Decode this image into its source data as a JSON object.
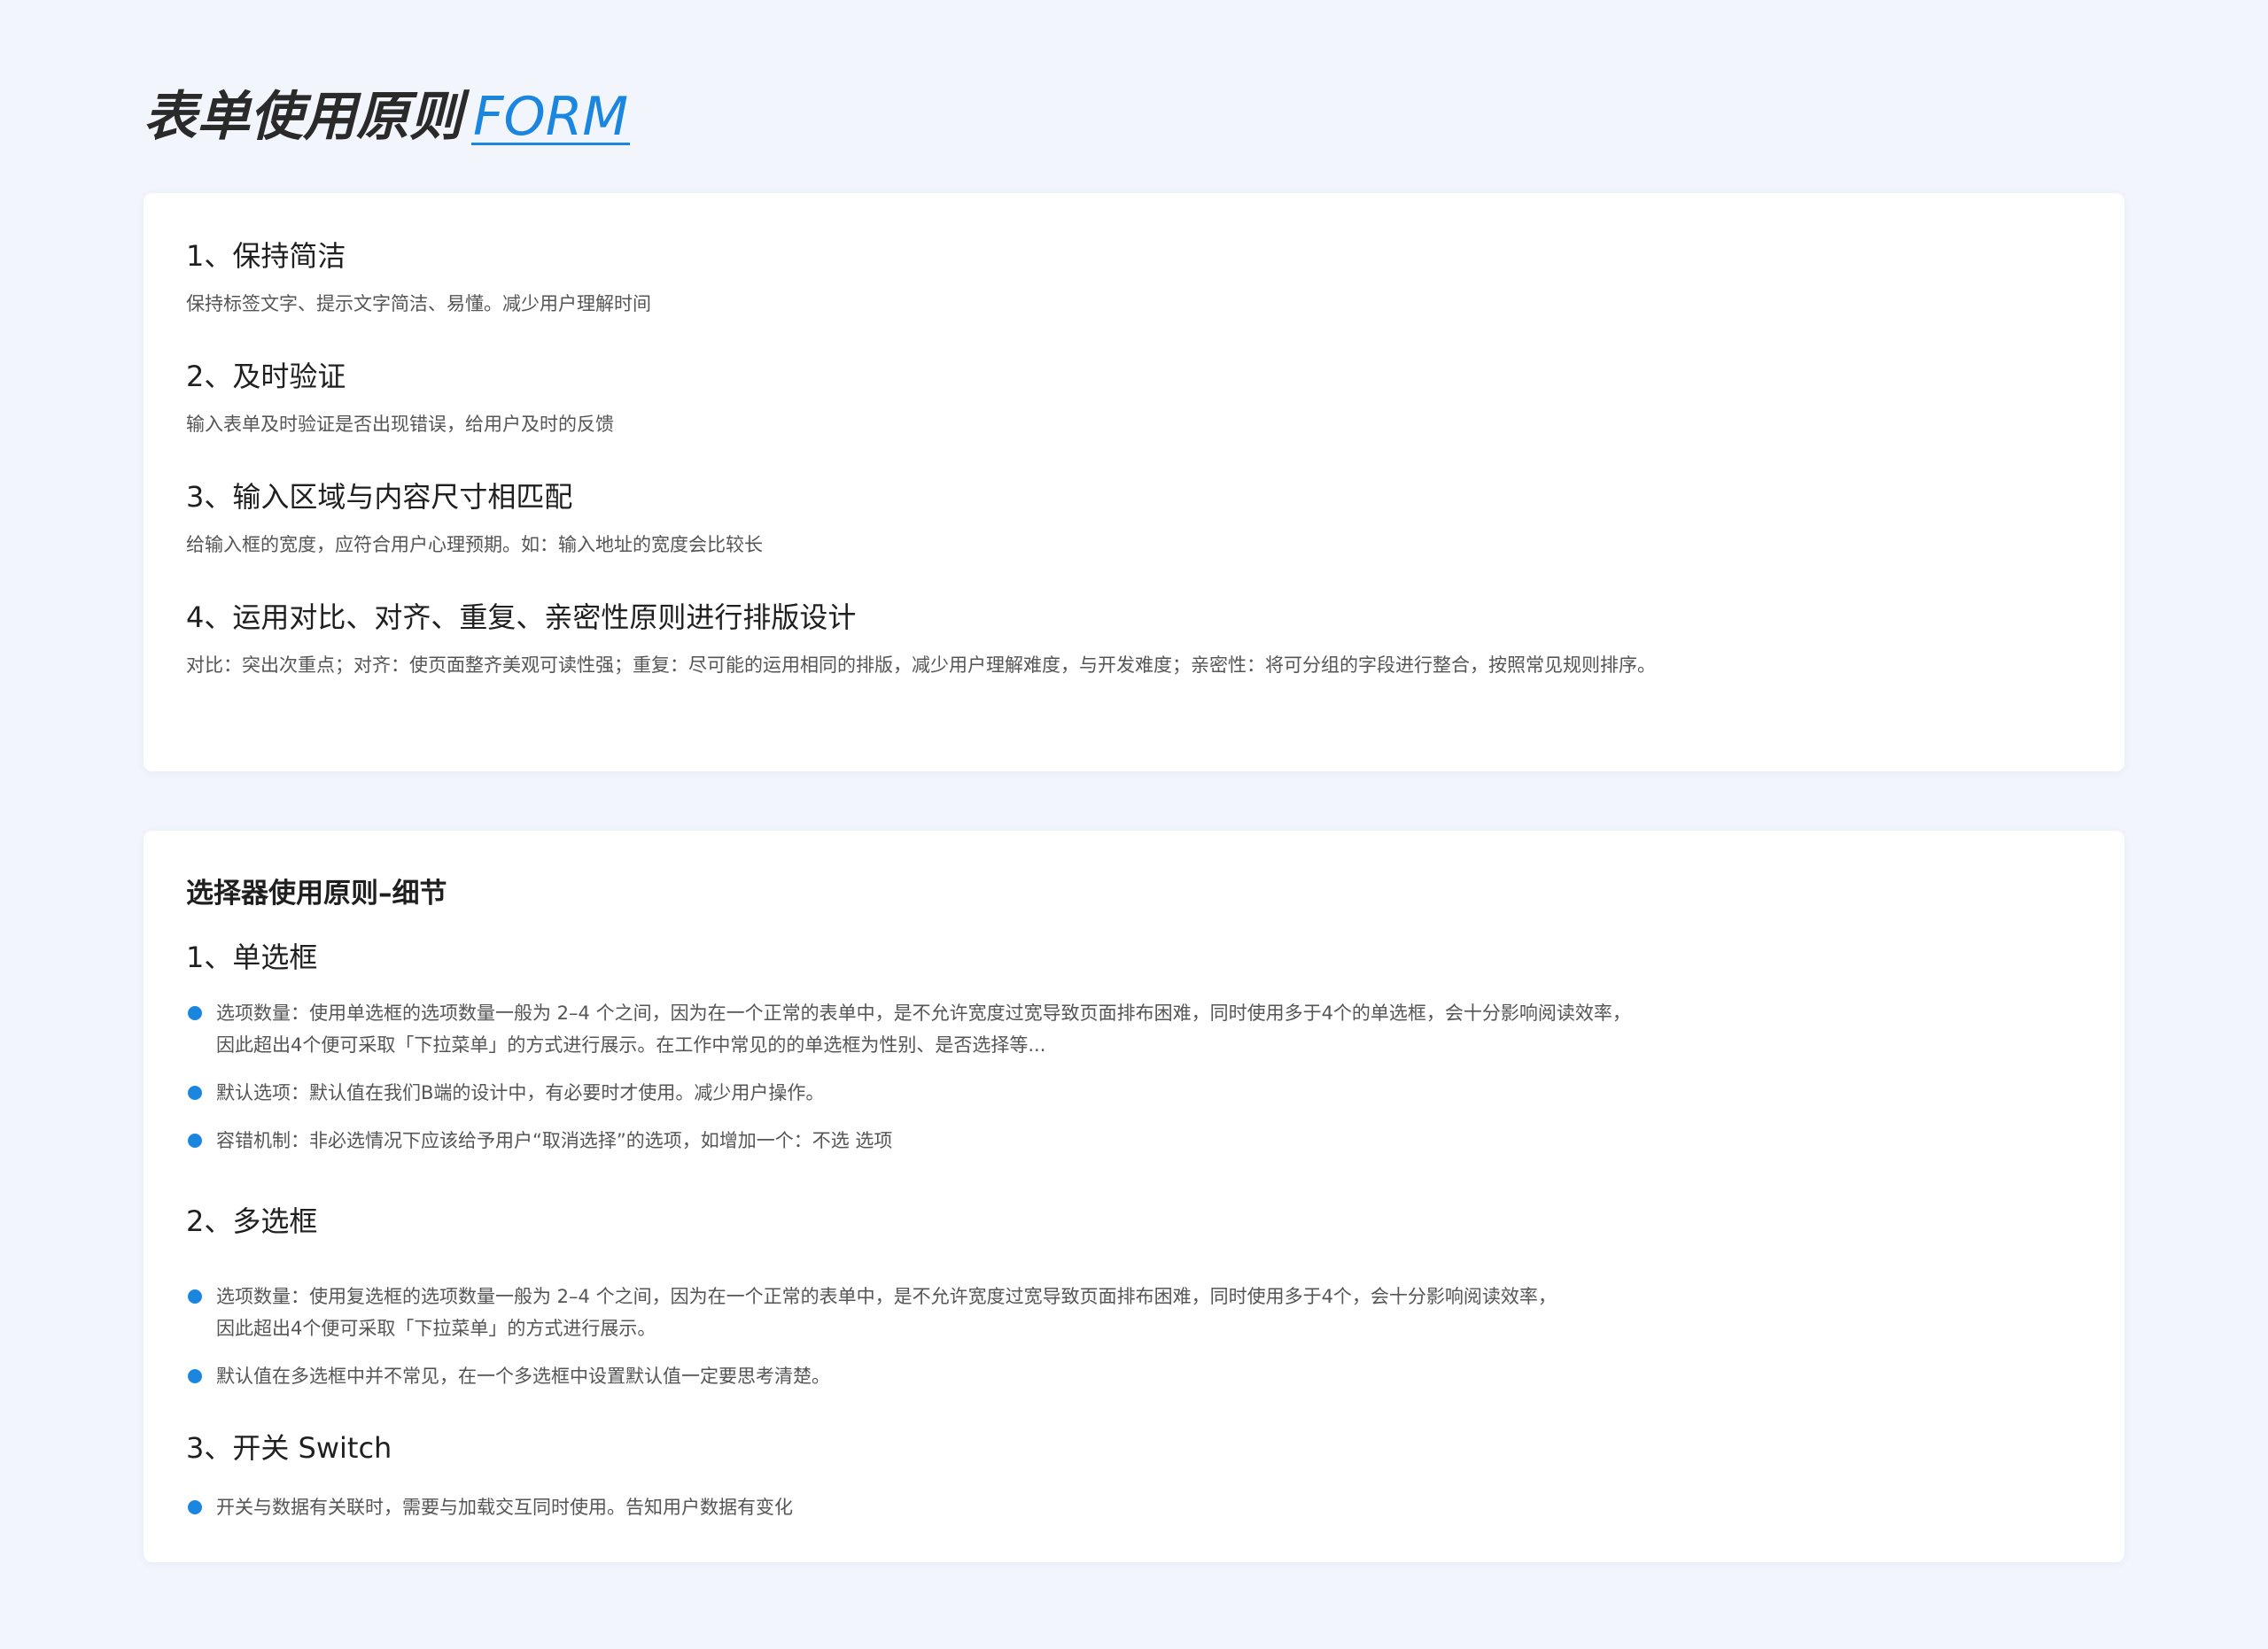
{
  "header": {
    "title": "表单使用原则",
    "accent": "FORM"
  },
  "principles": [
    {
      "title": "1、保持简洁",
      "desc": "保持标签文字、提示文字简洁、易懂。减少用户理解时间"
    },
    {
      "title": "2、及时验证",
      "desc": "输入表单及时验证是否出现错误，给用户及时的反馈"
    },
    {
      "title": "3、输入区域与内容尺寸相匹配",
      "desc": "给输入框的宽度，应符合用户心理预期。如：输入地址的宽度会比较长"
    },
    {
      "title": "4、运用对比、对齐、重复、亲密性原则进行排版设计",
      "desc": "对比：突出次重点；对齐：使页面整齐美观可读性强；重复：尽可能的运用相同的排版，减少用户理解难度，与开发难度；亲密性：将可分组的字段进行整合，按照常见规则排序。"
    }
  ],
  "selector": {
    "title": "选择器使用原则–细节",
    "radio": {
      "title": "1、单选框",
      "items": [
        {
          "line1": "选项数量：使用单选框的选项数量一般为 2–4 个之间，因为在一个正常的表单中，是不允许宽度过宽导致页面排布困难，同时使用多于4个的单选框，会十分影响阅读效率，",
          "line2": "因此超出4个便可采取「下拉菜单」的方式进行展示。在工作中常见的的单选框为性别、是否选择等..."
        },
        {
          "line1": "默认选项：默认值在我们B端的设计中，有必要时才使用。减少用户操作。",
          "line2": ""
        },
        {
          "line1": "容错机制：非必选情况下应该给予用户“取消选择”的选项，如增加一个：不选 选项",
          "line2": ""
        }
      ]
    },
    "checkbox": {
      "title": "2、多选框",
      "items": [
        {
          "line1": "选项数量：使用复选框的选项数量一般为 2–4 个之间，因为在一个正常的表单中，是不允许宽度过宽导致页面排布困难，同时使用多于4个，会十分影响阅读效率，",
          "line2": "因此超出4个便可采取「下拉菜单」的方式进行展示。"
        },
        {
          "line1": "默认值在多选框中并不常见，在一个多选框中设置默认值一定要思考清楚。",
          "line2": ""
        }
      ]
    },
    "switch": {
      "title": "3、开关 Switch",
      "items": [
        {
          "line1": "开关与数据有关联时，需要与加载交互同时使用。告知用户数据有变化",
          "line2": ""
        }
      ]
    }
  },
  "colors": {
    "background": "#f2f5fc",
    "accent": "#1b86e0",
    "card": "#ffffff"
  }
}
